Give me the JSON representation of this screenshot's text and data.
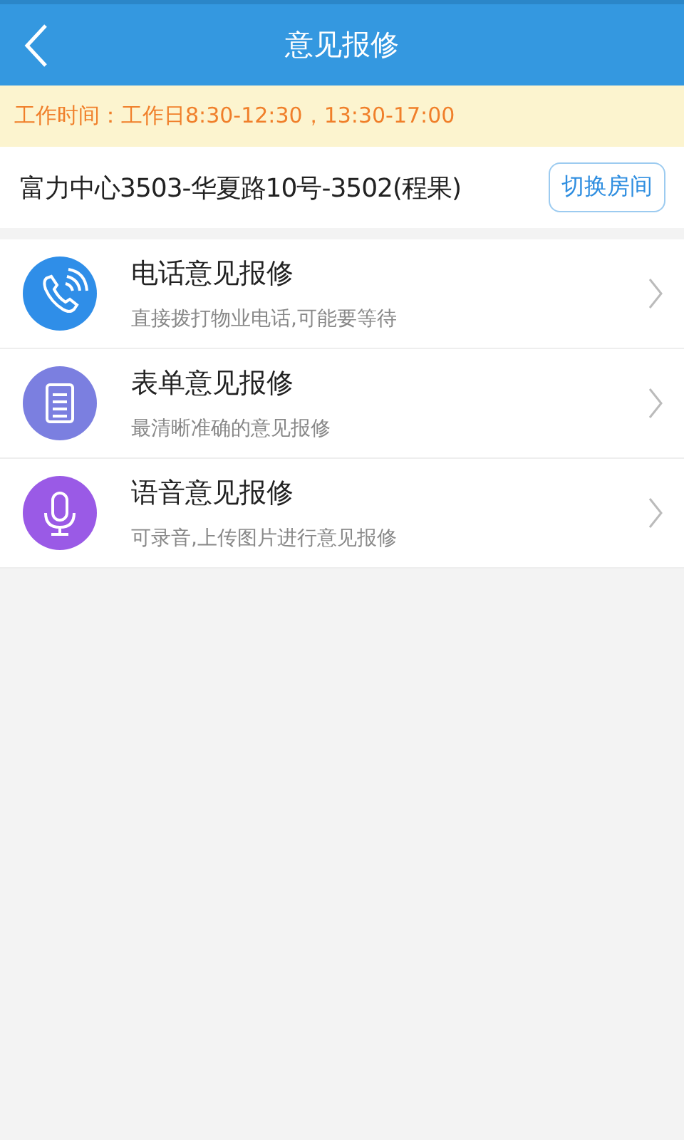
{
  "header": {
    "title": "意见报修"
  },
  "notice": {
    "label": "工作时间：",
    "text": "工作日8:30-12:30，13:30-17:00"
  },
  "address": {
    "text": "富力中心3503-华夏路10号-3502(程果)",
    "button": "切换房间"
  },
  "options": [
    {
      "kind": "phone",
      "color": "#2f8ee8",
      "title": "电话意见报修",
      "subtitle": "直接拨打物业电话,可能要等待"
    },
    {
      "kind": "form",
      "color": "#7b7fe0",
      "title": "表单意见报修",
      "subtitle": "最清晰准确的意见报修"
    },
    {
      "kind": "voice",
      "color": "#9a5ae6",
      "title": "语音意见报修",
      "subtitle": "可录音,上传图片进行意见报修"
    }
  ]
}
